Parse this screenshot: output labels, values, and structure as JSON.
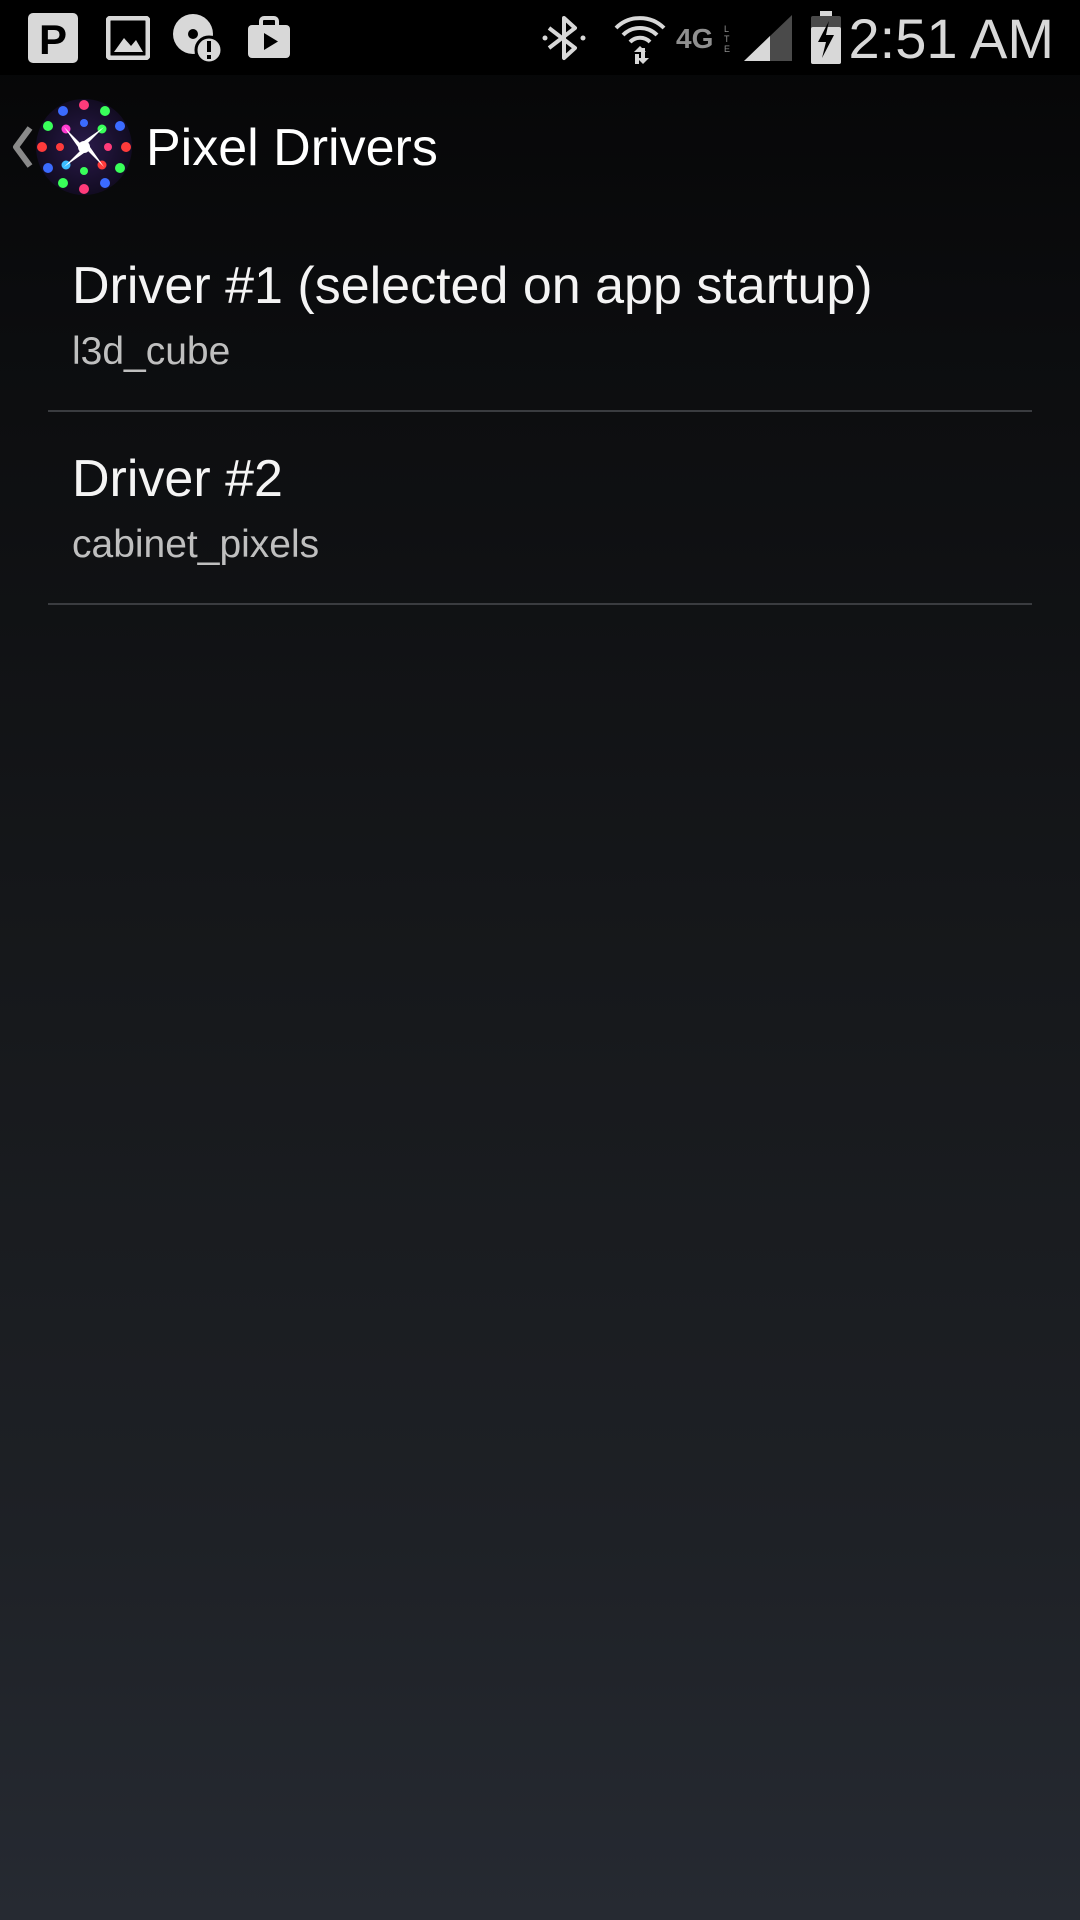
{
  "status_bar": {
    "time": "2:51 AM",
    "left_icons": [
      "parking-p-icon",
      "gallery-image-icon",
      "alert-disc-icon",
      "shopping-bag-icon"
    ],
    "right_icons": [
      "bluetooth-icon",
      "wifi-icon",
      "4g-lte-icon",
      "cell-signal-icon",
      "battery-charging-icon"
    ],
    "network_label": "4G"
  },
  "action_bar": {
    "title": "Pixel Drivers"
  },
  "drivers": [
    {
      "title": "Driver #1 (selected on app startup)",
      "summary": "l3d_cube"
    },
    {
      "title": "Driver #2",
      "summary": "cabinet_pixels"
    }
  ],
  "colors": {
    "status_bar_bg": "#000000",
    "divider": "#3a3c40",
    "primary_text": "#f4f4f4",
    "secondary_text": "#bfbfbf",
    "status_icon": "#d8d8d8"
  }
}
